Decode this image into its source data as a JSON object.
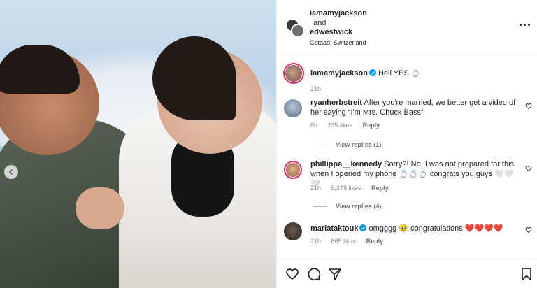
{
  "post": {
    "author_primary": "iamamyjackson",
    "conjunction": "and",
    "author_secondary": "edwestwick",
    "location": "Gstaad, Switzerland"
  },
  "caption": {
    "username": "iamamyjackson",
    "text": "Hell YES 💍",
    "time": "21h"
  },
  "comments": [
    {
      "username": "ryanherbstreit",
      "text": "After you're married, we better get a video of her saying “I'm Mrs. Chuck Bass”",
      "time": "8h",
      "likes": "135 likes",
      "reply": "Reply",
      "view_replies": "View replies (1)"
    },
    {
      "username": "phillippa__kennedy",
      "text": "Sorry?! No. I was not prepared for this when I opened my phone 💍💍💍 congrats you guys 🤍🤍🤍",
      "time": "21h",
      "likes": "5,279 likes",
      "reply": "Reply",
      "view_replies": "View replies (4)"
    },
    {
      "username": "mariataktouk",
      "text": "omgggg 🥹 congratulations ❤️❤️❤️❤️",
      "time": "21h",
      "likes": "865 likes",
      "reply": "Reply"
    }
  ],
  "colors": {
    "accent_story": "#e1306c",
    "verified": "#0095f6",
    "heart_red": "#ed4956"
  },
  "icons": [
    "more-options-icon",
    "verified-icon",
    "heart-icon",
    "comment-icon",
    "share-icon",
    "bookmark-icon",
    "chevron-left-icon"
  ]
}
